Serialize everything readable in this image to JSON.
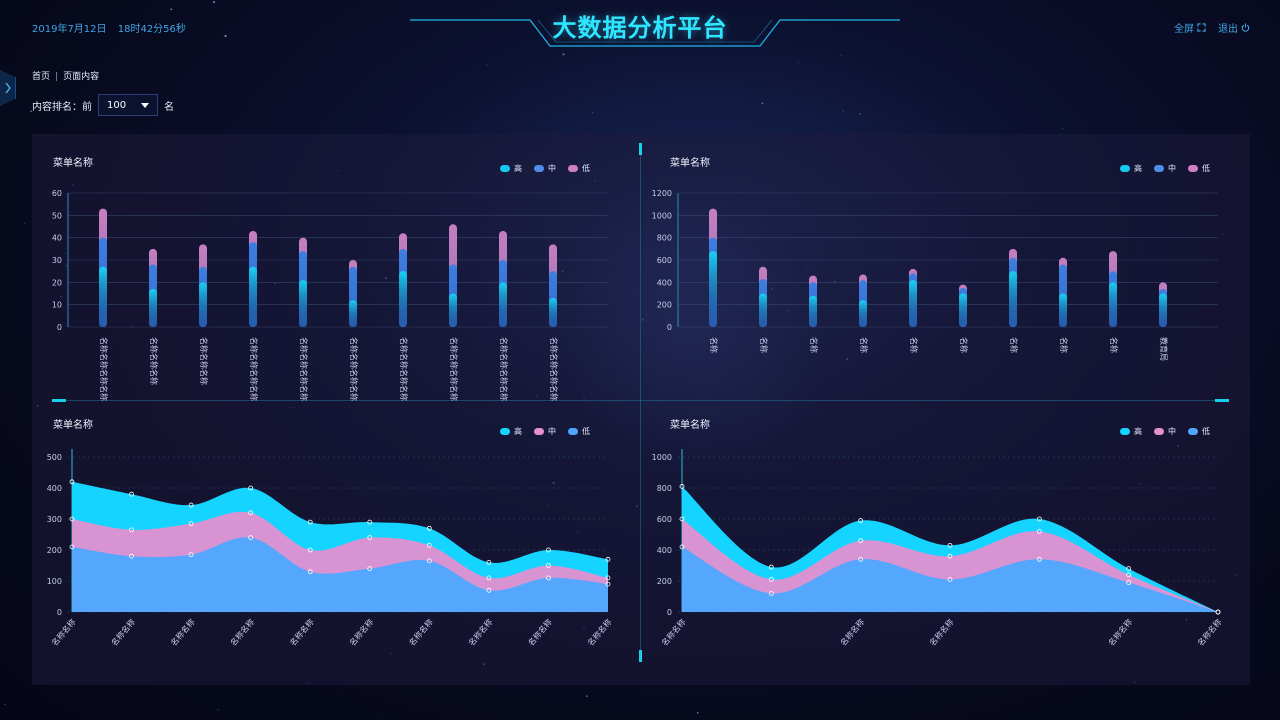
{
  "header": {
    "date": "2019年7月12日",
    "time": "18时42分56秒",
    "title": "大数据分析平台",
    "fullscreen_label": "全屏",
    "logout_label": "退出"
  },
  "breadcrumb": {
    "home": "首页",
    "separator": "|",
    "current": "页面内容"
  },
  "rank": {
    "prefix": "内容排名：前",
    "value": "100",
    "suffix": "名"
  },
  "colors": {
    "high": "#17c9f0",
    "mid": "#4f8de8",
    "low": "#d07fc3",
    "area_top": "#15d4ff",
    "area_mid": "#e38fd0",
    "area_base": "#4ea6ff",
    "accent": "#2ee6ff"
  },
  "chart_data": [
    {
      "type": "bar",
      "title": "菜单名称",
      "legend": [
        "高",
        "中",
        "低"
      ],
      "categories": [
        "名称名称名称名称",
        "名称名称名称",
        "名称名称名称",
        "名称名称名称名称",
        "名称名称名称名称",
        "名称名称名称名称",
        "名称名称名称名称",
        "名称名称名称名称",
        "名称名称名称名称",
        "名称名称名称名称"
      ],
      "series": [
        {
          "name": "高",
          "values": [
            27,
            17,
            20,
            27,
            21,
            12,
            25,
            15,
            20,
            13
          ]
        },
        {
          "name": "中",
          "values": [
            40,
            28,
            27,
            38,
            34,
            27,
            35,
            28,
            30,
            25
          ]
        },
        {
          "name": "低",
          "values": [
            53,
            35,
            37,
            43,
            40,
            30,
            42,
            46,
            43,
            37
          ]
        }
      ],
      "ylim": [
        0,
        60
      ],
      "yticks": [
        0,
        10,
        20,
        30,
        40,
        50,
        60
      ]
    },
    {
      "type": "bar",
      "title": "菜单名称",
      "legend": [
        "高",
        "中",
        "低"
      ],
      "categories": [
        "名称",
        "名称",
        "名称",
        "名称",
        "名称",
        "名称",
        "名称",
        "名称",
        "名称",
        "教育局"
      ],
      "series": [
        {
          "name": "高",
          "values": [
            680,
            300,
            280,
            240,
            420,
            300,
            500,
            300,
            400,
            300
          ]
        },
        {
          "name": "中",
          "values": [
            800,
            430,
            400,
            420,
            480,
            350,
            620,
            560,
            500,
            340
          ]
        },
        {
          "name": "低",
          "values": [
            1060,
            540,
            460,
            470,
            520,
            380,
            700,
            620,
            680,
            400
          ]
        }
      ],
      "ylim": [
        0,
        1200
      ],
      "yticks": [
        0,
        200,
        400,
        600,
        800,
        1000,
        1200
      ]
    },
    {
      "type": "area",
      "title": "菜单名称",
      "legend": [
        "高",
        "中",
        "低"
      ],
      "categories": [
        "名称名称",
        "名称名称",
        "名称名称",
        "名称名称",
        "名称名称",
        "名称名称",
        "名称名称",
        "名称名称",
        "名称名称",
        "名称名称"
      ],
      "series": [
        {
          "name": "高",
          "values": [
            420,
            380,
            345,
            400,
            290,
            290,
            270,
            160,
            200,
            170
          ]
        },
        {
          "name": "中",
          "values": [
            300,
            265,
            285,
            320,
            200,
            240,
            215,
            110,
            150,
            110
          ]
        },
        {
          "name": "低",
          "values": [
            210,
            180,
            185,
            240,
            130,
            140,
            165,
            70,
            110,
            90
          ]
        }
      ],
      "ylim": [
        0,
        500
      ],
      "yticks": [
        0,
        100,
        200,
        300,
        400,
        500
      ]
    },
    {
      "type": "area",
      "title": "菜单名称",
      "legend": [
        "高",
        "中",
        "低"
      ],
      "categories": [
        "名称名称",
        "名称名称",
        "名称名称",
        "名称名称",
        "名称名称"
      ],
      "series": [
        {
          "name": "高",
          "values": [
            810,
            290,
            590,
            430,
            600,
            280,
            0
          ]
        },
        {
          "name": "中",
          "values": [
            600,
            210,
            460,
            360,
            520,
            240,
            0
          ]
        },
        {
          "name": "低",
          "values": [
            420,
            120,
            340,
            210,
            340,
            190,
            0
          ]
        }
      ],
      "ylim": [
        0,
        1000
      ],
      "yticks": [
        0,
        200,
        400,
        600,
        800,
        1000
      ]
    }
  ]
}
